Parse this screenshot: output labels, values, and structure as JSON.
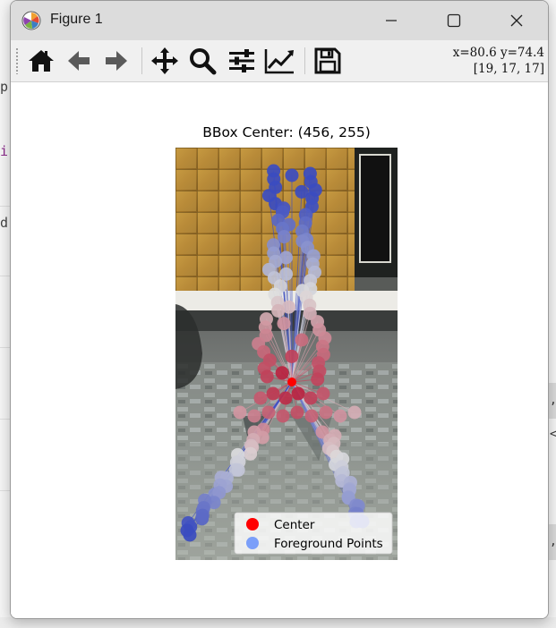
{
  "window": {
    "title": "Figure 1"
  },
  "toolbar": {
    "items": [
      "home-icon",
      "back-icon",
      "forward-icon",
      "pan-icon",
      "zoom-icon",
      "configure-subplots-icon",
      "edit-axis-icon",
      "save-icon"
    ],
    "coord_line1": "x=80.6 y=74.4",
    "coord_line2": "[19, 17, 17]"
  },
  "plot": {
    "title": "BBox Center: (456, 255)",
    "legend": {
      "center_label": "Center",
      "foreground_label": "Foreground Points"
    },
    "colors": {
      "center": "#ff0000",
      "foreground_legend": "#7b9ff9",
      "cmap_low": "#3b4cc0",
      "cmap_mid": "#dddddd",
      "cmap_high": "#b40426"
    }
  },
  "background": {
    "glyphs": [
      "p",
      "i",
      "d",
      ",",
      "<",
      ","
    ]
  }
}
